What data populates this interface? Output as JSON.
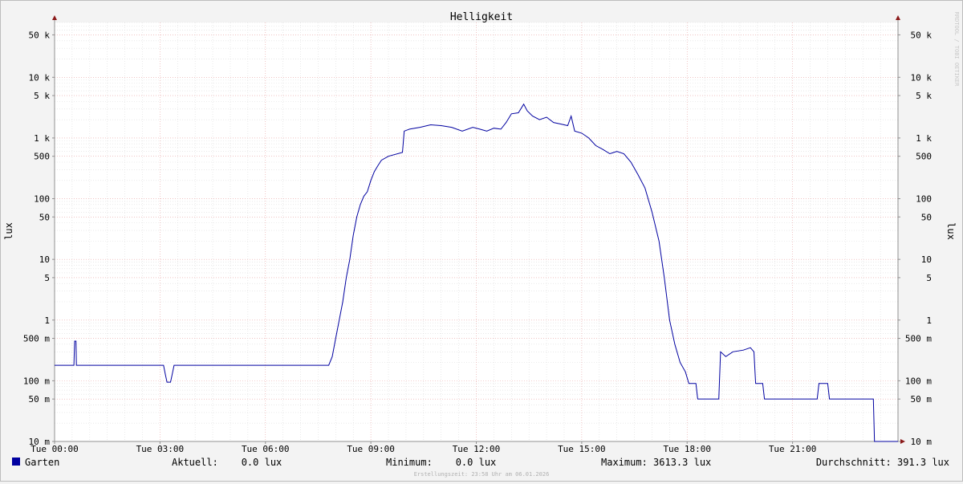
{
  "chart_data": {
    "type": "line",
    "title": "Helligkeit",
    "ylabel": "lux",
    "ylabel_right": "lux",
    "watermark": "RRDTOOL / TOBI OETIKER",
    "y_scale": "log",
    "ylim": [
      0.01,
      80000
    ],
    "xlim_hours": [
      0,
      24
    ],
    "x_ticks": [
      {
        "h": 0,
        "label": "Tue 00:00"
      },
      {
        "h": 3,
        "label": "Tue 03:00"
      },
      {
        "h": 6,
        "label": "Tue 06:00"
      },
      {
        "h": 9,
        "label": "Tue 09:00"
      },
      {
        "h": 12,
        "label": "Tue 12:00"
      },
      {
        "h": 15,
        "label": "Tue 15:00"
      },
      {
        "h": 18,
        "label": "Tue 18:00"
      },
      {
        "h": 21,
        "label": "Tue 21:00"
      }
    ],
    "y_ticks": [
      {
        "v": 0.01,
        "label": "10 m"
      },
      {
        "v": 0.05,
        "label": "50 m"
      },
      {
        "v": 0.1,
        "label": "100 m"
      },
      {
        "v": 0.5,
        "label": "500 m"
      },
      {
        "v": 1,
        "label": "1"
      },
      {
        "v": 5,
        "label": "5"
      },
      {
        "v": 10,
        "label": "10"
      },
      {
        "v": 50,
        "label": "50"
      },
      {
        "v": 100,
        "label": "100"
      },
      {
        "v": 500,
        "label": "500"
      },
      {
        "v": 1000,
        "label": "1 k"
      },
      {
        "v": 5000,
        "label": "5 k"
      },
      {
        "v": 10000,
        "label": "10 k"
      },
      {
        "v": 50000,
        "label": "50 k"
      }
    ],
    "grid": true,
    "series": [
      {
        "name": "Garten",
        "color": "#0000a0",
        "points": [
          [
            0.0,
            0.18
          ],
          [
            0.55,
            0.18
          ],
          [
            0.57,
            0.45
          ],
          [
            0.61,
            0.45
          ],
          [
            0.62,
            0.18
          ],
          [
            3.1,
            0.18
          ],
          [
            3.15,
            0.13
          ],
          [
            3.2,
            0.095
          ],
          [
            3.3,
            0.095
          ],
          [
            3.35,
            0.13
          ],
          [
            3.4,
            0.18
          ],
          [
            7.8,
            0.18
          ],
          [
            7.9,
            0.25
          ],
          [
            8.0,
            0.5
          ],
          [
            8.1,
            1.0
          ],
          [
            8.2,
            2.0
          ],
          [
            8.3,
            5.0
          ],
          [
            8.4,
            10.0
          ],
          [
            8.5,
            25.0
          ],
          [
            8.6,
            50.0
          ],
          [
            8.7,
            80.0
          ],
          [
            8.8,
            110.0
          ],
          [
            8.9,
            130.0
          ],
          [
            9.0,
            200.0
          ],
          [
            9.1,
            280.0
          ],
          [
            9.2,
            350.0
          ],
          [
            9.3,
            430.0
          ],
          [
            9.5,
            500.0
          ],
          [
            9.9,
            580.0
          ],
          [
            9.95,
            1300.0
          ],
          [
            10.1,
            1400.0
          ],
          [
            10.4,
            1500.0
          ],
          [
            10.7,
            1650.0
          ],
          [
            11.0,
            1600.0
          ],
          [
            11.3,
            1500.0
          ],
          [
            11.6,
            1300.0
          ],
          [
            11.9,
            1500.0
          ],
          [
            12.1,
            1400.0
          ],
          [
            12.3,
            1300.0
          ],
          [
            12.5,
            1450.0
          ],
          [
            12.7,
            1400.0
          ],
          [
            12.85,
            1800.0
          ],
          [
            13.0,
            2500.0
          ],
          [
            13.2,
            2600.0
          ],
          [
            13.35,
            3600.0
          ],
          [
            13.45,
            2800.0
          ],
          [
            13.6,
            2300.0
          ],
          [
            13.8,
            2000.0
          ],
          [
            14.0,
            2200.0
          ],
          [
            14.2,
            1800.0
          ],
          [
            14.4,
            1700.0
          ],
          [
            14.6,
            1600.0
          ],
          [
            14.7,
            2300.0
          ],
          [
            14.8,
            1300.0
          ],
          [
            15.0,
            1200.0
          ],
          [
            15.2,
            1000.0
          ],
          [
            15.4,
            750.0
          ],
          [
            15.6,
            650.0
          ],
          [
            15.8,
            550.0
          ],
          [
            16.0,
            600.0
          ],
          [
            16.2,
            550.0
          ],
          [
            16.4,
            400.0
          ],
          [
            16.6,
            250.0
          ],
          [
            16.8,
            150.0
          ],
          [
            17.0,
            60.0
          ],
          [
            17.2,
            20.0
          ],
          [
            17.35,
            5.0
          ],
          [
            17.5,
            1.0
          ],
          [
            17.65,
            0.4
          ],
          [
            17.8,
            0.2
          ],
          [
            17.95,
            0.14
          ],
          [
            18.05,
            0.09
          ],
          [
            18.25,
            0.09
          ],
          [
            18.3,
            0.05
          ],
          [
            18.9,
            0.05
          ],
          [
            18.95,
            0.3
          ],
          [
            19.1,
            0.25
          ],
          [
            19.3,
            0.3
          ],
          [
            19.6,
            0.32
          ],
          [
            19.8,
            0.35
          ],
          [
            19.9,
            0.3
          ],
          [
            19.95,
            0.09
          ],
          [
            20.15,
            0.09
          ],
          [
            20.2,
            0.05
          ],
          [
            21.7,
            0.05
          ],
          [
            21.75,
            0.09
          ],
          [
            22.0,
            0.09
          ],
          [
            22.05,
            0.05
          ],
          [
            23.3,
            0.05
          ],
          [
            23.33,
            0.01
          ],
          [
            24.0,
            0.01
          ]
        ]
      }
    ]
  },
  "legend": {
    "series_name": "Garten",
    "series_color": "#0000a0",
    "current": "Aktuell:    0.0 lux",
    "minimum": "Minimum:    0.0 lux",
    "maximum": "Maximum: 3613.3 lux",
    "average": "Durchschnitt: 391.3 lux"
  },
  "footer": "Erstellungszeit: 23:58 Uhr am 06.01.2026"
}
